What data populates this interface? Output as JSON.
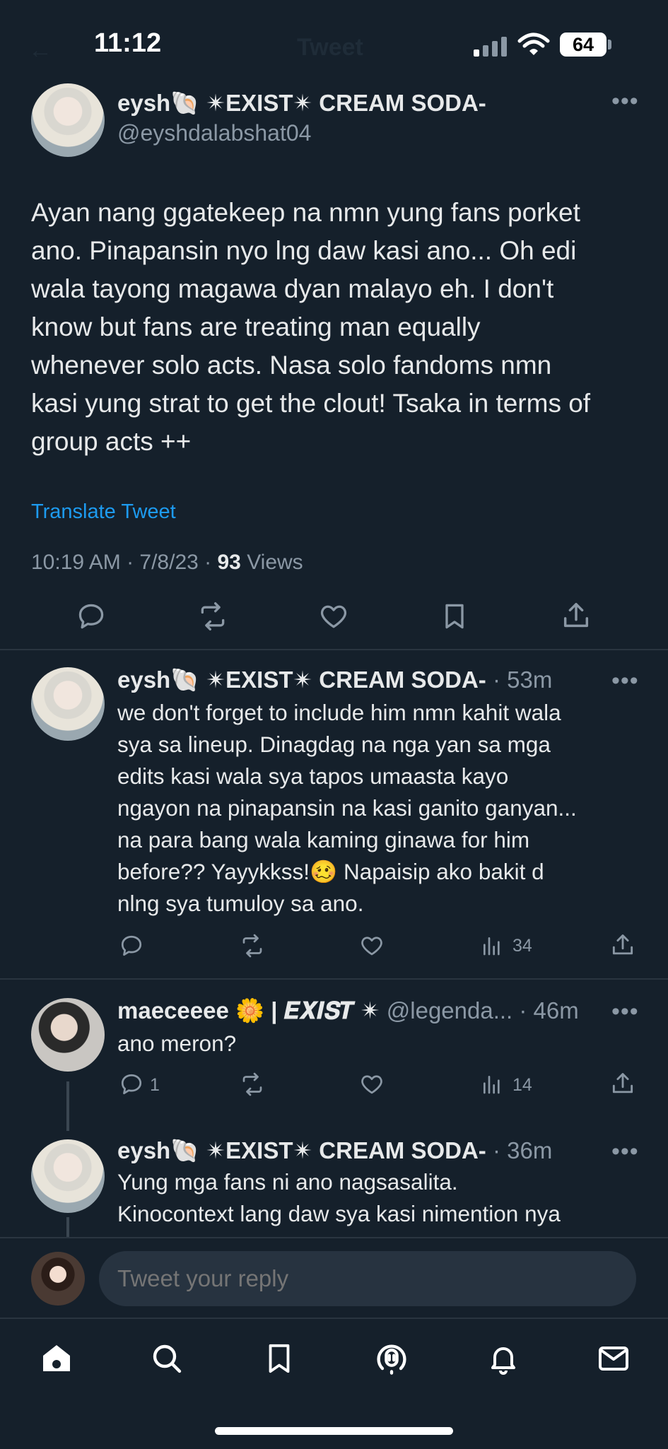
{
  "status_bar": {
    "time": "11:12",
    "battery": "64"
  },
  "header": {
    "title": "Tweet"
  },
  "main_tweet": {
    "display_name": "eysh🐚 ✴EXIST✴ CREAM SODA-",
    "handle": "@eyshdalabshat04",
    "text_lines": [
      "Ayan nang ggatekeep na nmn yung fans porket",
      "ano. Pinapansin nyo lng daw kasi ano... Oh edi",
      "wala tayong magawa dyan malayo eh. I don't",
      "know but fans are treating man equally",
      "whenever solo acts. Nasa solo fandoms nmn",
      "kasi yung strat to get the clout! Tsaka in terms of",
      "group acts ++"
    ],
    "translate": "Translate Tweet",
    "meta": "10:19 AM · 7/8/23 · ",
    "views_count": "93",
    "views_label": " Views"
  },
  "replies": [
    {
      "display_name": "eysh🐚 ✴EXIST✴ CREAM SODA-",
      "time": " · 53m",
      "text_lines": [
        "we don't forget to include him nmn kahit wala",
        "sya sa lineup. Dinagdag na nga yan sa mga",
        "edits kasi wala sya tapos umaasta kayo",
        "ngayon na pinapansin na kasi ganito ganyan...",
        "na para bang wala kaming ginawa for him",
        "before?? Yayykkss!🥴 Napaisip ako bakit d",
        "nlng sya tumuloy sa ano."
      ],
      "views": "34"
    },
    {
      "display_name": "maeceeee 🌼 | 𝑬𝑿𝑰𝑺𝑻 ✴",
      "handle": " @legenda...",
      "time": " · 46m",
      "text_lines": [
        "ano meron?"
      ],
      "replies_count": "1",
      "views": "14"
    },
    {
      "display_name": "eysh🐚 ✴EXIST✴ CREAM SODA-",
      "time": " · 36m",
      "text_lines": [
        "Yung mga fans ni ano nagsasalita.",
        "Kinocontext lang daw sya kasi nimention nya"
      ]
    }
  ],
  "reply_box": {
    "placeholder": "Tweet your reply"
  },
  "colors": {
    "background": "#15202b",
    "link": "#1d9bf0",
    "muted": "#8b98a5"
  }
}
